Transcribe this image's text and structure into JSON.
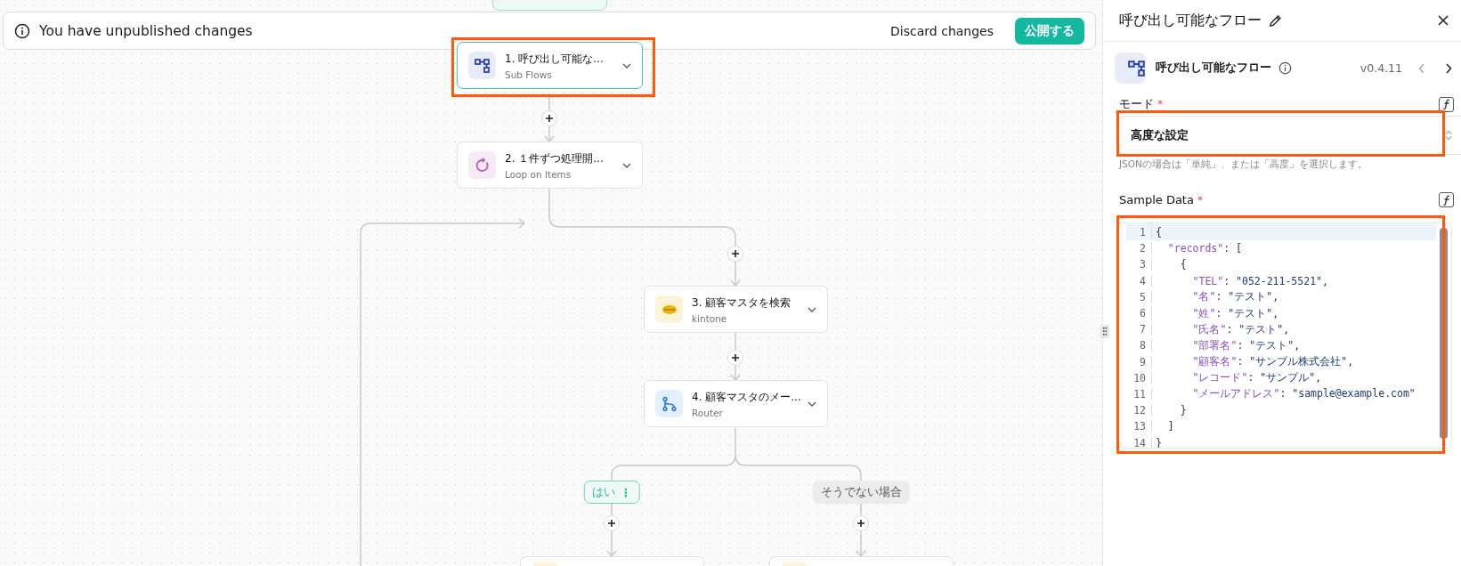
{
  "banner": {
    "message": "You have unpublished changes",
    "discard": "Discard changes",
    "publish": "公開する"
  },
  "steps": [
    {
      "title": "1. 呼び出し可能な...",
      "subtitle": "Sub Flows",
      "kind": "subflow",
      "selected": true
    },
    {
      "title": "2. １件ずつ処理開...",
      "subtitle": "Loop on Items",
      "kind": "loop",
      "selected": false
    },
    {
      "title": "3. 顧客マスタを検索",
      "subtitle": "kintone",
      "kind": "kintone",
      "selected": false
    },
    {
      "title": "4. 顧客マスタのメー...",
      "subtitle": "Router",
      "kind": "router",
      "selected": false
    },
    {
      "kind": "kintone",
      "selected": false
    },
    {
      "kind": "kintone",
      "selected": false
    }
  ],
  "highlights": [
    {
      "kind": "first_step"
    },
    {
      "kind": "mode"
    },
    {
      "kind": "sample_data"
    }
  ],
  "branches": [
    {
      "label": "はい",
      "kind": "condition",
      "menu": "⋮"
    },
    {
      "label": "そうでない場合",
      "kind": "fallback"
    }
  ],
  "panel": {
    "title": "呼び出し可能なフロー",
    "app_name": "呼び出し可能なフロー",
    "version": "v0.4.11",
    "prev_disabled": true,
    "next_disabled": false,
    "mode": {
      "label": "モード",
      "required_mark": "*",
      "value": "高度な設定",
      "help": "JSONの場合は「単純」、または「高度」を選択します。"
    },
    "sample_data": {
      "label": "Sample Data",
      "required_mark": "*",
      "lines": [
        {
          "number": "1",
          "code": "{"
        },
        {
          "number": "2",
          "code": "  \"records\": ["
        },
        {
          "number": "3",
          "code": "    {"
        },
        {
          "number": "4",
          "code": "      \"TEL\": \"052-211-5521\","
        },
        {
          "number": "5",
          "code": "      \"名\": \"テスト\","
        },
        {
          "number": "6",
          "code": "      \"姓\": \"テスト\","
        },
        {
          "number": "7",
          "code": "      \"氏名\": \"テスト\","
        },
        {
          "number": "8",
          "code": "      \"部署名\": \"テスト\","
        },
        {
          "number": "9",
          "code": "      \"顧客名\": \"サンプル株式会社\","
        },
        {
          "number": "10",
          "code": "      \"レコード\": \"サンプル\","
        },
        {
          "number": "11",
          "code": "      \"メールアドレス\": \"sample@example.com\""
        },
        {
          "number": "12",
          "code": "    }"
        },
        {
          "number": "13",
          "code": "  ]"
        },
        {
          "number": "14",
          "code": "}"
        }
      ]
    }
  }
}
